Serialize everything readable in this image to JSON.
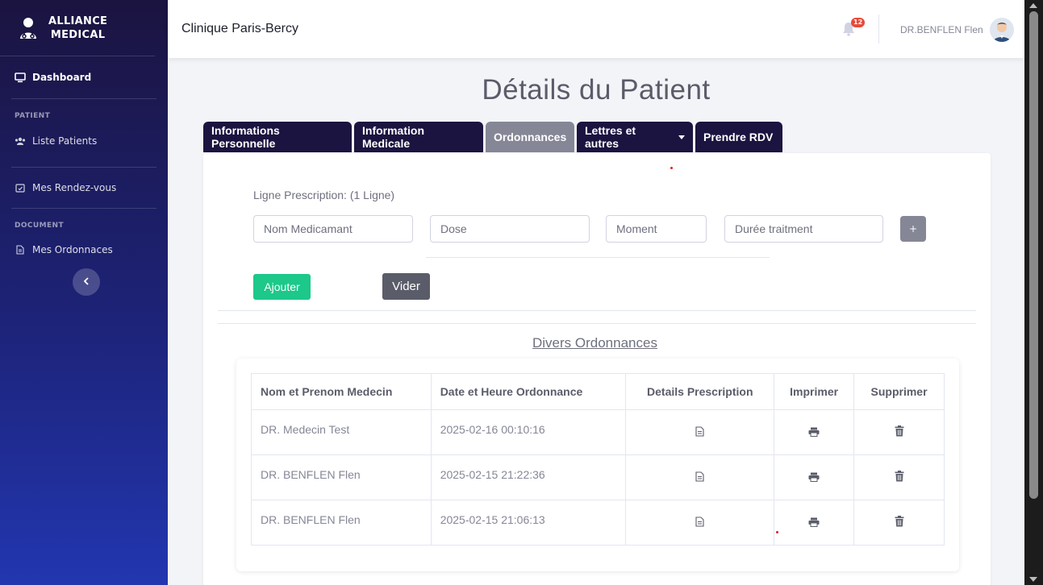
{
  "brand": {
    "line1": "ALLIANCE",
    "line2": "MEDICAL",
    "icon": "doctor-icon"
  },
  "sidebar": {
    "dashboard": "Dashboard",
    "heading_patient": "PATIENT",
    "liste_patients": "Liste Patients",
    "mes_rdv": "Mes Rendez-vous",
    "heading_document": "DOCUMENT",
    "mes_ordonnances": "Mes Ordonnaces",
    "toggle_icon": "chevron-left-icon"
  },
  "topbar": {
    "clinic": "Clinique Paris-Bercy",
    "notification_count": "12",
    "user_name": "DR.BENFLEN Flen"
  },
  "page": {
    "title": "Détails du Patient"
  },
  "tabs": [
    {
      "label": "Informations Personnelle"
    },
    {
      "label": "Information Medicale"
    },
    {
      "label": "Ordonnances"
    },
    {
      "label": "Lettres et autres"
    },
    {
      "label": "Prendre RDV"
    }
  ],
  "active_tab": "Ordonnances",
  "prescription": {
    "label": "Ligne Prescription: (1 Ligne)",
    "placeholders": {
      "medicament": "Nom Medicamant",
      "dose": "Dose",
      "moment": "Moment",
      "duree": "Durée traitment"
    },
    "plus": "+",
    "add_button": "Ajouter",
    "clear_button": "Vider"
  },
  "ordonnances": {
    "title": "Divers Ordonnances",
    "headers": {
      "medecin": "Nom et Prenom Medecin",
      "date": "Date et Heure Ordonnance",
      "details": "Details Prescription",
      "imprimer": "Imprimer",
      "supprimer": "Supprimer"
    },
    "rows": [
      {
        "medecin": "DR. Medecin Test",
        "date": "2025-02-16 00:10:16"
      },
      {
        "medecin": "DR. BENFLEN Flen",
        "date": "2025-02-15 21:22:36"
      },
      {
        "medecin": "DR. BENFLEN Flen",
        "date": "2025-02-15 21:06:13"
      }
    ]
  },
  "colors": {
    "sidebar_top": "#1b1440",
    "sidebar_bottom": "#2236b0",
    "tab_bg": "#1b1440",
    "tab_active": "#858796",
    "success": "#1cc88a",
    "badge": "#e74a3b"
  }
}
